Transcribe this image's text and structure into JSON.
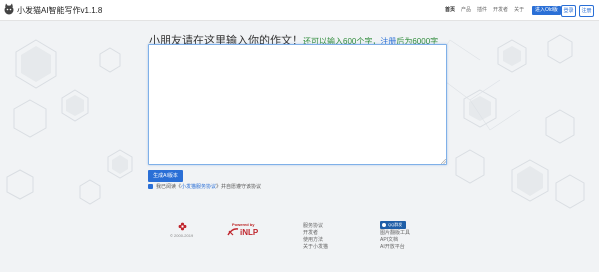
{
  "header": {
    "app_title": "小发猫AI智能写作v1.1.8",
    "nav": [
      "首页",
      "产品",
      "插件",
      "开发者",
      "关于"
    ],
    "enter_label": "进入Old版",
    "login_label": "登录",
    "register_label": "注册"
  },
  "main": {
    "heading": "小朋友请在这里输入你的作文！",
    "limit_prefix": "还可以输入600个字，",
    "limit_link": "注册",
    "limit_suffix": "后为6000字",
    "essay_value": "",
    "generate_label": "生成AI版本",
    "agree_prefix": "我已阅读《",
    "agree_link": "小发猫服务协议",
    "agree_suffix": "》并自愿遵守该协议"
  },
  "footer": {
    "copyright": "© 2000-2019",
    "powered_by": "Powered by",
    "brand": "iNLP",
    "links_col1": [
      "服务协议",
      "开发者",
      "使用方法",
      "关于小发猫"
    ],
    "qq_label": "QQ群发",
    "links_col2": [
      "图片翻版工具",
      "API文档",
      "AI开放平台"
    ]
  },
  "colors": {
    "accent": "#2a6fd6",
    "green_text": "#2e8b3a",
    "brand_red": "#c0262e"
  }
}
